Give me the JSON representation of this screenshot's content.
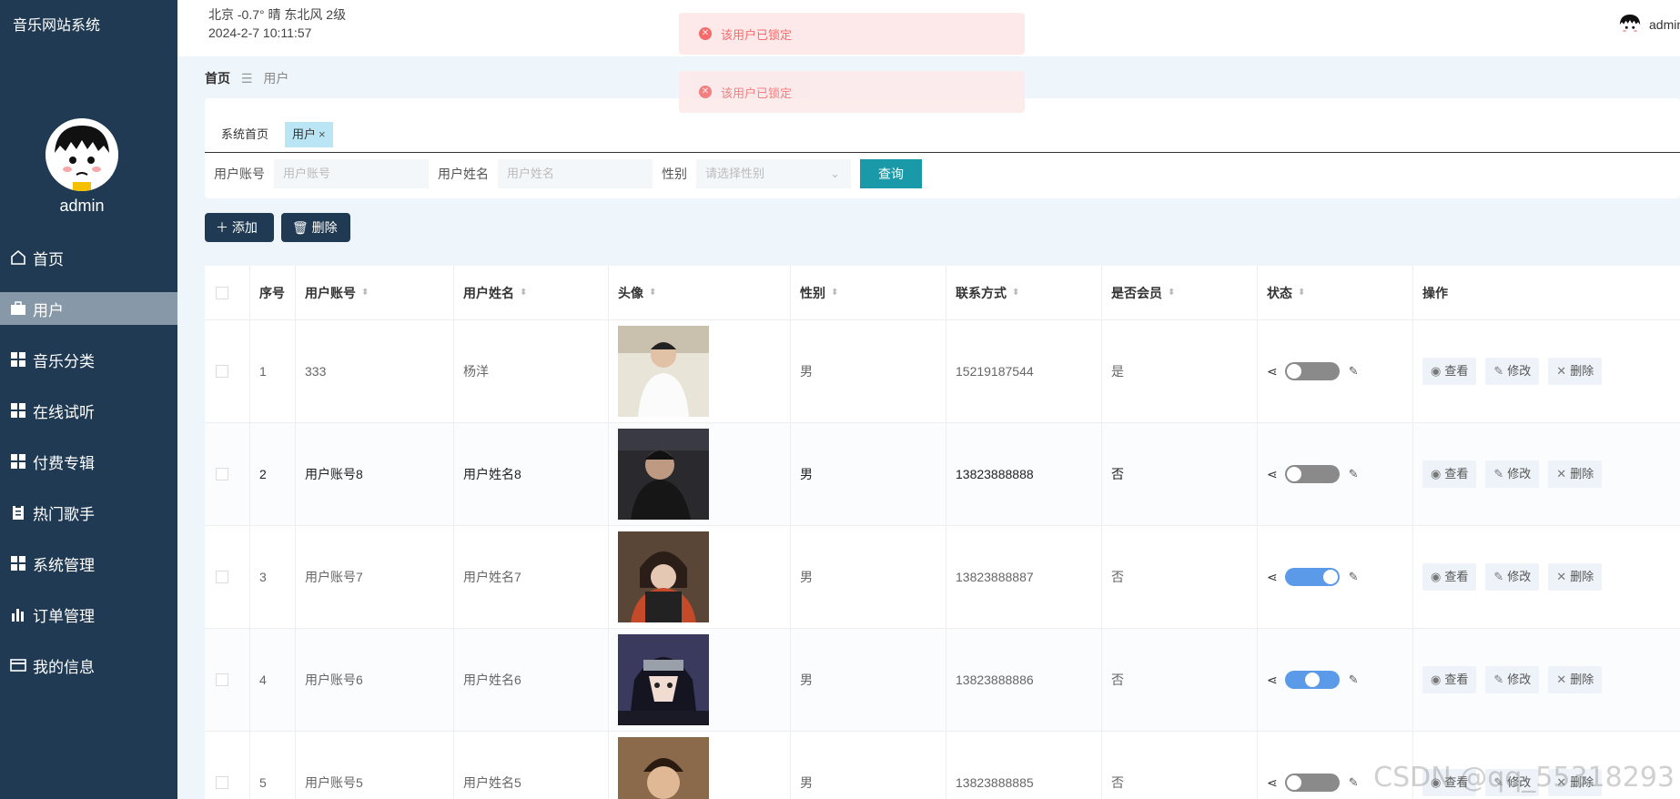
{
  "app": {
    "title": "音乐网站系统"
  },
  "sidebar": {
    "username": "admin",
    "items": [
      {
        "label": "首页",
        "icon": "home-icon"
      },
      {
        "label": "用户",
        "icon": "briefcase-icon"
      },
      {
        "label": "音乐分类",
        "icon": "grid-icon"
      },
      {
        "label": "在线试听",
        "icon": "grid-icon"
      },
      {
        "label": "付费专辑",
        "icon": "grid-icon"
      },
      {
        "label": "热门歌手",
        "icon": "clipboard-icon"
      },
      {
        "label": "系统管理",
        "icon": "grid-icon"
      },
      {
        "label": "订单管理",
        "icon": "bar-chart-icon"
      },
      {
        "label": "我的信息",
        "icon": "card-icon"
      }
    ]
  },
  "topbar": {
    "weather": "北京  -0.7°  晴  东北风  2级",
    "datetime": "2024-2-7 10:11:57",
    "user": "admin"
  },
  "breadcrumb": {
    "home": "首页",
    "current": "用户"
  },
  "tabs": [
    {
      "label": "系统首页"
    },
    {
      "label": "用户"
    }
  ],
  "search": {
    "account_label": "用户账号",
    "account_placeholder": "用户账号",
    "name_label": "用户姓名",
    "name_placeholder": "用户姓名",
    "gender_label": "性别",
    "gender_placeholder": "请选择性别",
    "query_label": "查询"
  },
  "actions": {
    "add_label": "添加",
    "delete_label": "删除"
  },
  "table": {
    "headers": [
      "序号",
      "用户账号",
      "用户姓名",
      "头像",
      "性别",
      "联系方式",
      "是否会员",
      "状态",
      "操作"
    ],
    "rows": [
      {
        "index": "1",
        "account": "333",
        "name": "杨洋",
        "gender": "男",
        "phone": "15219187544",
        "member": "是",
        "status_on": false
      },
      {
        "index": "2",
        "account": "用户账号8",
        "name": "用户姓名8",
        "gender": "男",
        "phone": "13823888888",
        "member": "否",
        "status_on": false
      },
      {
        "index": "3",
        "account": "用户账号7",
        "name": "用户姓名7",
        "gender": "男",
        "phone": "13823888887",
        "member": "否",
        "status_on": true
      },
      {
        "index": "4",
        "account": "用户账号6",
        "name": "用户姓名6",
        "gender": "男",
        "phone": "13823888886",
        "member": "否",
        "status_on": true
      },
      {
        "index": "5",
        "account": "用户账号5",
        "name": "用户姓名5",
        "gender": "男",
        "phone": "13823888885",
        "member": "否",
        "status_on": false
      }
    ],
    "ops": {
      "view": "查看",
      "edit": "修改",
      "delete": "删除"
    }
  },
  "toasts": [
    {
      "text": "该用户已锁定"
    },
    {
      "text": "该用户已锁定"
    }
  ],
  "watermark": "CSDN @qq_55318293",
  "colors": {
    "sidebar": "#1f3a52",
    "accent": "#1a9aa8",
    "toggle_on": "#5b9ae8",
    "error": "#f56c6c"
  }
}
